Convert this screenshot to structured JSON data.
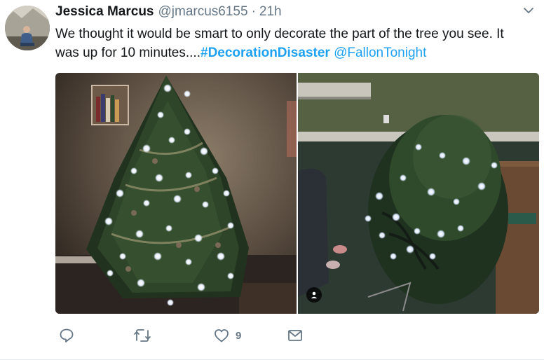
{
  "tweet": {
    "author_name": "Jessica Marcus",
    "handle": "@jmarcus6155",
    "separator": "·",
    "time": "21h",
    "text_line1": "We thought it would be smart to only decorate the part of the tree you see. It",
    "text_line2_prefix": "was up for 10 minutes....",
    "hashtag": "#DecorationDisaster",
    "mention": "@FallonTonight"
  },
  "actions": {
    "reply_icon": "reply-icon",
    "retweet_icon": "retweet-icon",
    "like_icon": "heart-icon",
    "like_count": "9",
    "dm_icon": "envelope-icon"
  },
  "media": {
    "left_photo": "decorated-christmas-tree-in-corner",
    "right_photo": "fallen-christmas-tree-on-floor"
  },
  "colors": {
    "link": "#1da1f2",
    "secondary_text": "#657786",
    "primary_text": "#14171a"
  }
}
